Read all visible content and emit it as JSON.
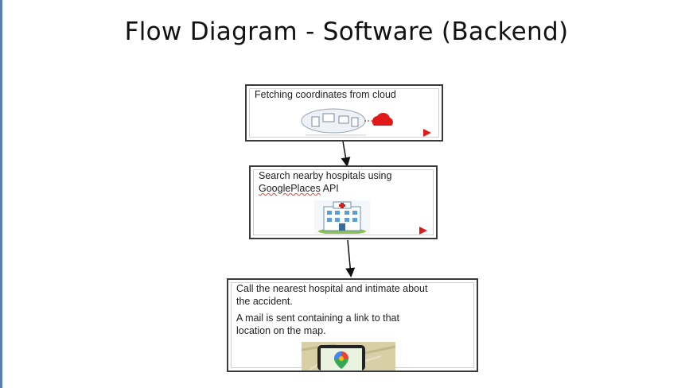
{
  "title": "Flow Diagram - Software (Backend)",
  "steps": [
    {
      "text": "Fetching coordinates from cloud",
      "icon": "cloud-devices-icon"
    },
    {
      "text_part1": "Search nearby hospitals using",
      "text_link": "GooglePlaces",
      "text_part2": " API",
      "icon": "hospital-building-icon"
    },
    {
      "text1": "Call the nearest hospital and intimate about the accident.",
      "text2": "A mail is sent containing a link to that location on the map.",
      "icon": "google-maps-phone-icon"
    }
  ],
  "colors": {
    "border": "#3a3a3a",
    "play": "#e01a1a",
    "accent": "#5b7fb0"
  }
}
